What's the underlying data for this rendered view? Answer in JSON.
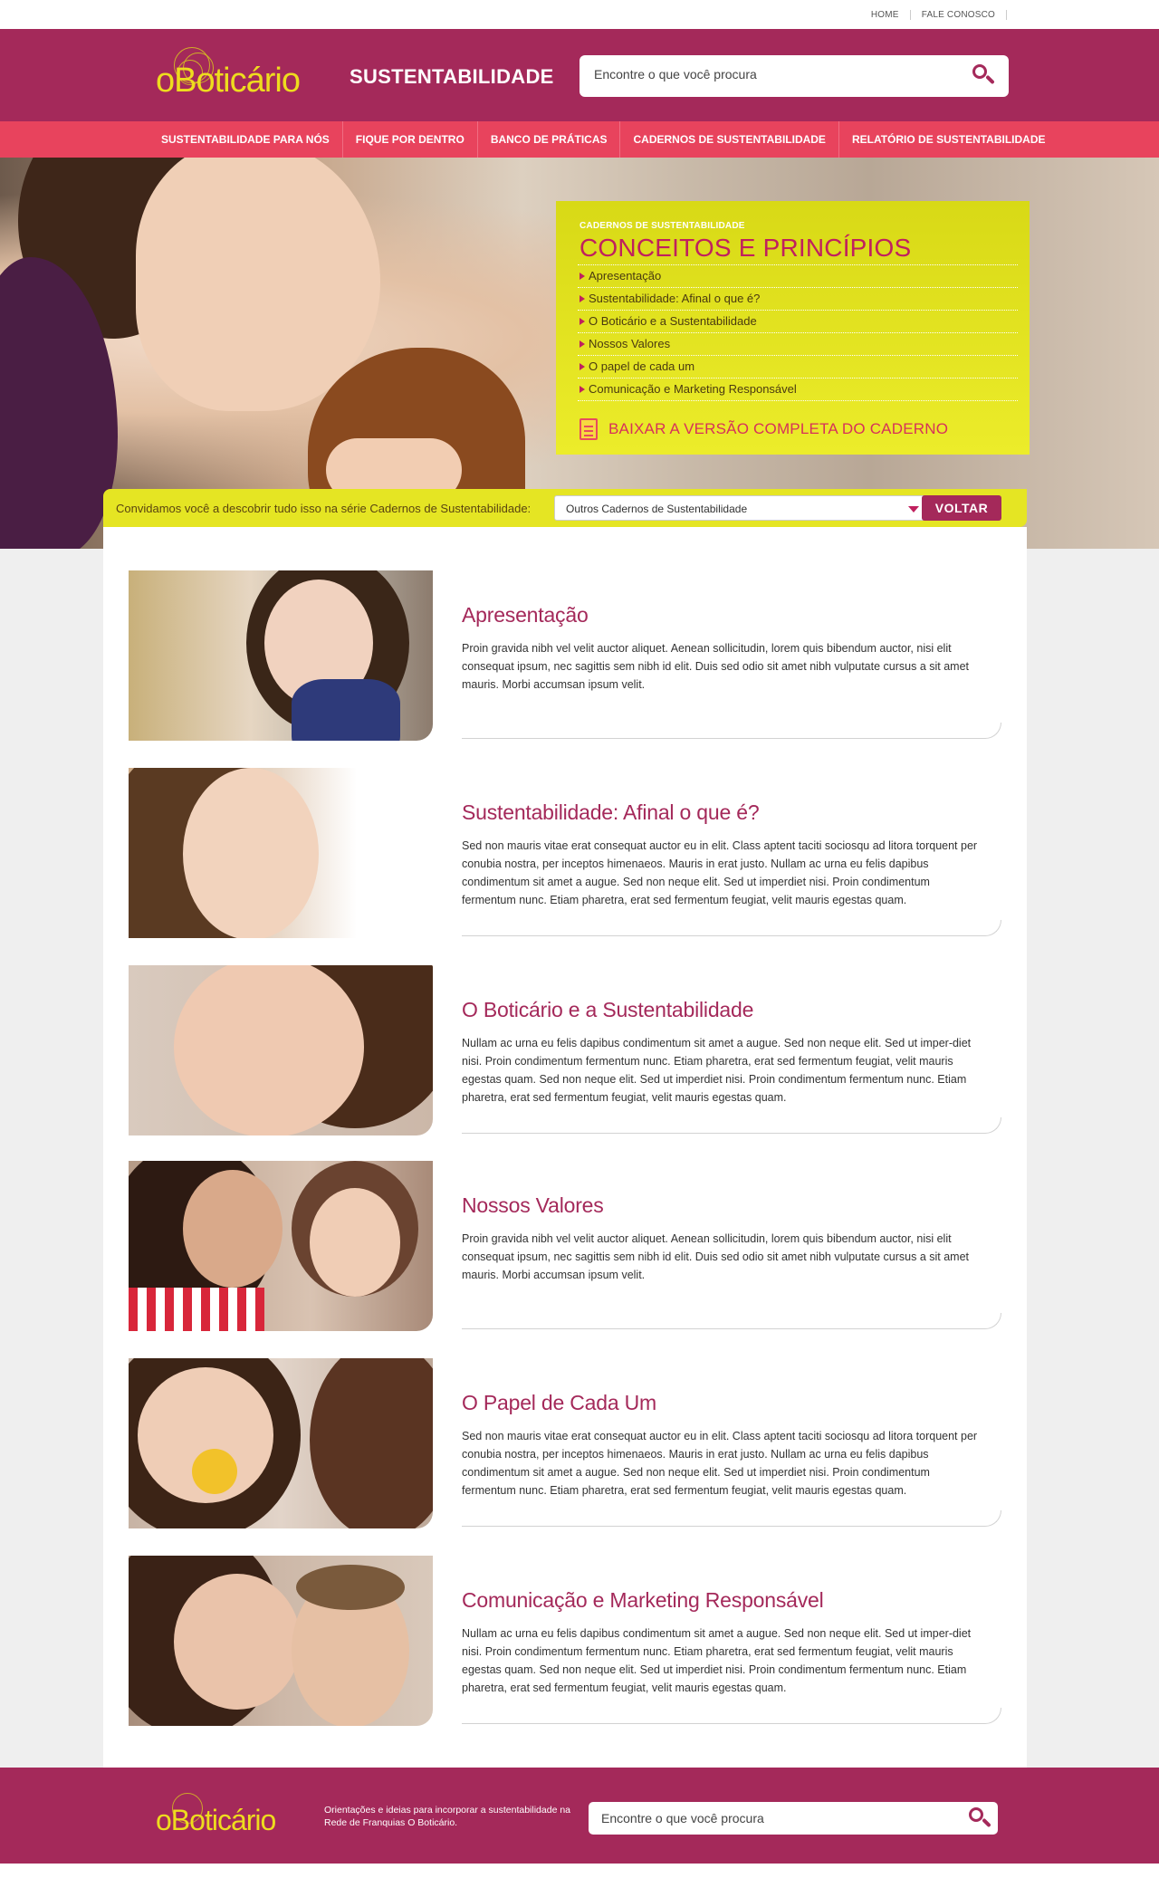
{
  "topbar": {
    "links": [
      "HOME",
      "FALE CONOSCO"
    ]
  },
  "header": {
    "logo_text": "oBoticário",
    "section_title": "SUSTENTABILIDADE",
    "search_placeholder": "Encontre o que você procura"
  },
  "nav": {
    "items": [
      "SUSTENTABILIDADE PARA NÓS",
      "FIQUE POR DENTRO",
      "BANCO DE PRÁTICAS",
      "CADERNOS DE SUSTENTABILIDADE",
      "RELATÓRIO DE SUSTENTABILIDADE"
    ]
  },
  "panel": {
    "kicker": "CADERNOS DE SUSTENTABILIDADE",
    "title": "CONCEITOS E PRINCÍPIOS",
    "links": [
      "Apresentação",
      "Sustentabilidade: Afinal o que é?",
      "O Boticário e a Sustentabilidade",
      "Nossos Valores",
      "O papel  de cada um",
      "Comunicação e Marketing Responsável"
    ],
    "download": "BAIXAR A VERSÃO COMPLETA DO CADERNO"
  },
  "invite": {
    "text": "Convidamos você a descobrir tudo isso na série Cadernos de Sustentabilidade:",
    "select_value": "Outros Cadernos de Sustentabilidade",
    "button": "VOLTAR"
  },
  "items": [
    {
      "title": "Apresentação",
      "body": "Proin gravida nibh vel velit auctor aliquet. Aenean sollicitudin, lorem quis bibendum auctor, nisi elit consequat ipsum, nec sagittis sem nibh id elit. Duis sed odio sit amet nibh vulputate cursus a sit amet mauris. Morbi accumsan ipsum velit."
    },
    {
      "title": "Sustentabilidade: Afinal o que é?",
      "body": "Sed non  mauris vitae erat consequat auctor eu in elit. Class aptent taciti sociosqu ad litora torquent per conubia nostra, per inceptos himenaeos. Mauris in erat justo. Nullam ac urna eu felis dapibus condimentum sit amet a augue. Sed non neque elit. Sed ut imperdiet nisi. Proin condimentum fermentum nunc. Etiam pharetra, erat sed fermentum feugiat, velit mauris egestas quam."
    },
    {
      "title": "O Boticário e a Sustentabilidade",
      "body": "Nullam ac urna eu felis dapibus condimentum sit amet a augue. Sed non neque elit. Sed ut imper-diet nisi. Proin condimentum fermentum nunc. Etiam pharetra, erat sed fermentum feugiat, velit mauris egestas quam. Sed non neque elit. Sed ut imperdiet nisi. Proin condimentum fermentum nunc. Etiam pharetra, erat sed fermentum feugiat, velit mauris egestas quam."
    },
    {
      "title": "Nossos Valores",
      "body": "Proin gravida nibh vel velit auctor aliquet. Aenean sollicitudin, lorem quis bibendum auctor, nisi elit consequat ipsum, nec sagittis sem nibh id elit. Duis sed odio sit amet nibh vulputate cursus a sit amet mauris. Morbi accumsan ipsum velit."
    },
    {
      "title": "O Papel de Cada Um",
      "body": "Sed non  mauris vitae erat consequat auctor eu in elit. Class aptent taciti sociosqu ad litora torquent per conubia nostra, per inceptos himenaeos. Mauris in erat justo. Nullam ac urna eu felis dapibus condimentum sit amet a augue. Sed non neque elit. Sed ut imperdiet nisi. Proin condimentum fermentum nunc. Etiam pharetra, erat sed fermentum feugiat, velit mauris egestas quam."
    },
    {
      "title": "Comunicação e Marketing Responsável",
      "body": "Nullam ac urna eu felis dapibus condimentum sit amet a augue. Sed non neque elit. Sed ut imper-diet nisi. Proin condimentum fermentum nunc. Etiam pharetra, erat sed fermentum feugiat, velit mauris egestas quam. Sed non neque elit. Sed ut imperdiet nisi. Proin condimentum fermentum nunc. Etiam pharetra, erat sed fermentum feugiat, velit mauris egestas quam."
    }
  ],
  "footer": {
    "logo_text": "oBoticário",
    "tagline": "Orientações e ideias para incorporar a sustentabilidade na Rede de Franquias O Boticário.",
    "search_placeholder": "Encontre o que você procura"
  },
  "colors": {
    "brand": "#a4295a",
    "nav": "#e8435d",
    "accent_yellow": "#e5e523",
    "logo_yellow": "#eedc1e"
  }
}
